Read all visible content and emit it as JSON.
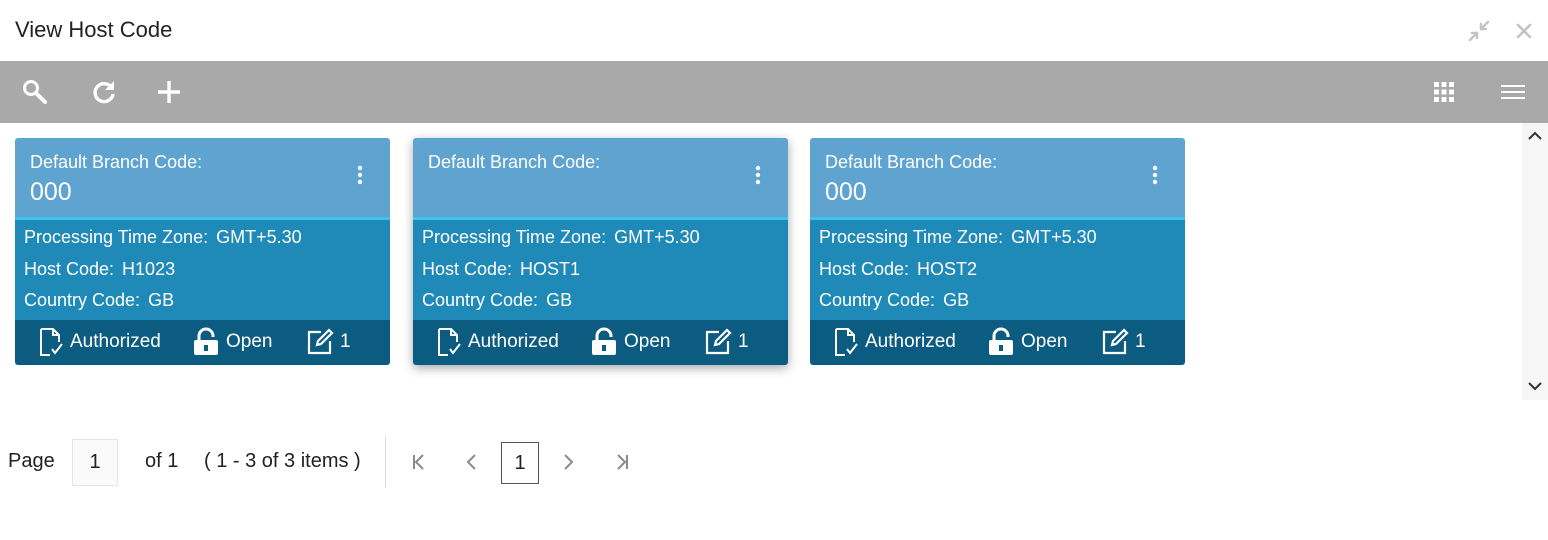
{
  "window": {
    "title": "View Host Code",
    "minimize_icon": "collapse-arrows-icon",
    "close_icon": "close-icon"
  },
  "toolbar": {
    "search_icon": "search-icon",
    "refresh_icon": "refresh-icon",
    "add_icon": "plus-icon",
    "grid_view_icon": "grid-view-icon",
    "list_view_icon": "list-view-icon",
    "background_color": "#a9a9a9"
  },
  "cards": [
    {
      "branch_label": "Default Branch Code:",
      "branch_value": "000",
      "tz_label": "Processing Time Zone:",
      "tz_value": "GMT+5.30",
      "host_label": "Host Code:",
      "host_value": "H1023",
      "country_label": "Country Code:",
      "country_value": "GB",
      "status": "Authorized",
      "lock": "Open",
      "edits": "1"
    },
    {
      "branch_label": "Default Branch Code:",
      "branch_value": "",
      "tz_label": "Processing Time Zone:",
      "tz_value": "GMT+5.30",
      "host_label": "Host Code:",
      "host_value": "HOST1",
      "country_label": "Country Code:",
      "country_value": "GB",
      "status": "Authorized",
      "lock": "Open",
      "edits": "1"
    },
    {
      "branch_label": "Default Branch Code:",
      "branch_value": "000",
      "tz_label": "Processing Time Zone:",
      "tz_value": "GMT+5.30",
      "host_label": "Host Code:",
      "host_value": "HOST2",
      "country_label": "Country Code:",
      "country_value": "GB",
      "status": "Authorized",
      "lock": "Open",
      "edits": "1"
    }
  ],
  "colors": {
    "card_header": "#5fa3d0",
    "card_body": "#1f89b8",
    "card_footer": "#0c5b80",
    "card_separator": "#3ec3ef"
  },
  "pagination": {
    "page_label": "Page",
    "page_input_value": "1",
    "of_label": "of 1",
    "range_label": "( 1 - 3 of 3 items )",
    "current_page": "1"
  }
}
